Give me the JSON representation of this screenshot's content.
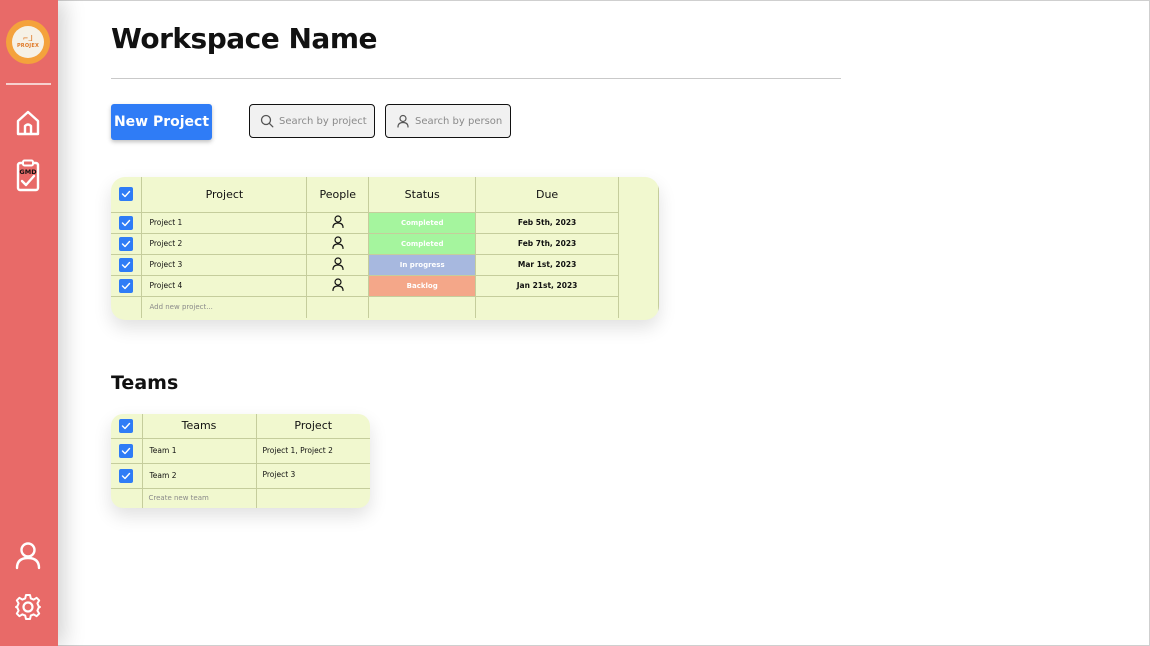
{
  "app": {
    "logo_mark": "⌐ᒧ",
    "logo_text": "PROJEX"
  },
  "sidebar": {
    "items": [
      {
        "icon": "home-icon"
      },
      {
        "icon": "clipboard-icon",
        "badge": "GMD"
      },
      {
        "icon": "user-icon"
      },
      {
        "icon": "gear-icon"
      }
    ]
  },
  "header": {
    "title": "Workspace Name"
  },
  "toolbar": {
    "new_project_label": "New Project",
    "search_project_placeholder": "Search by project",
    "search_person_placeholder": "Search by person"
  },
  "projects_table": {
    "headers": [
      "Project",
      "People",
      "Status",
      "Due"
    ],
    "rows": [
      {
        "name": "Project 1",
        "status": "Completed",
        "status_color": "#a5f59e",
        "due": "Feb 5th, 2023"
      },
      {
        "name": "Project 2",
        "status": "Completed",
        "status_color": "#a5f59e",
        "due": "Feb 7th, 2023"
      },
      {
        "name": "Project 3",
        "status": "In progress",
        "status_color": "#a7b8df",
        "due": "Mar 1st, 2023"
      },
      {
        "name": "Project 4",
        "status": "Backlog",
        "status_color": "#f4a789",
        "due": "Jan 21st, 2023"
      }
    ],
    "add_placeholder": "Add new project..."
  },
  "teams_section": {
    "title": "Teams",
    "headers": [
      "Teams",
      "Project"
    ],
    "rows": [
      {
        "name": "Team 1",
        "projects": "Project 1, Project 2"
      },
      {
        "name": "Team 2",
        "projects": "Project 3"
      }
    ],
    "add_placeholder": "Create new team"
  },
  "colors": {
    "sidebar": "#e86a68",
    "accent": "#2f7cf6",
    "table_bg": "#f1f8cf"
  }
}
